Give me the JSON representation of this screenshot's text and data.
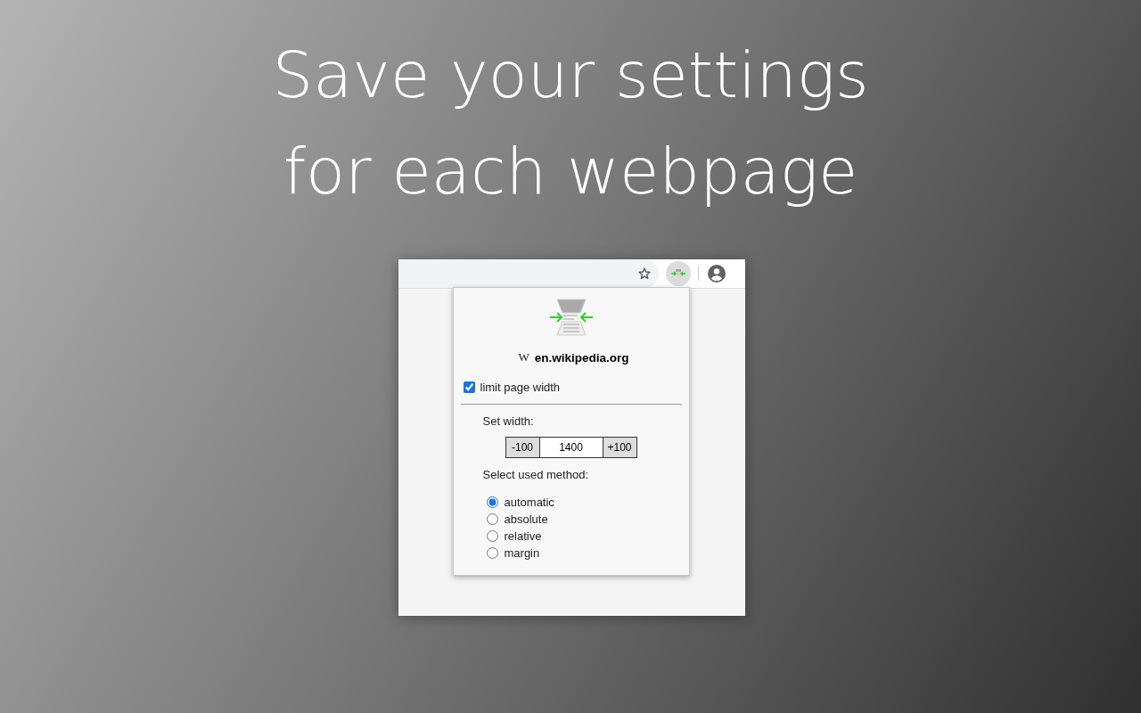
{
  "headline": [
    "Save your settings",
    "for each webpage"
  ],
  "browser": {
    "toolbar": {
      "extension_active": true
    }
  },
  "popup": {
    "site_icon": "W",
    "site": "en.wikipedia.org",
    "limit_checkbox": {
      "label": "limit page width",
      "checked": true
    },
    "width_label": "Set width:",
    "width": {
      "decrease": "-100",
      "value": "1400",
      "increase": "+100"
    },
    "method_label": "Select used method:",
    "methods": [
      {
        "label": "automatic",
        "selected": true
      },
      {
        "label": "absolute",
        "selected": false
      },
      {
        "label": "relative",
        "selected": false
      },
      {
        "label": "margin",
        "selected": false
      }
    ]
  }
}
